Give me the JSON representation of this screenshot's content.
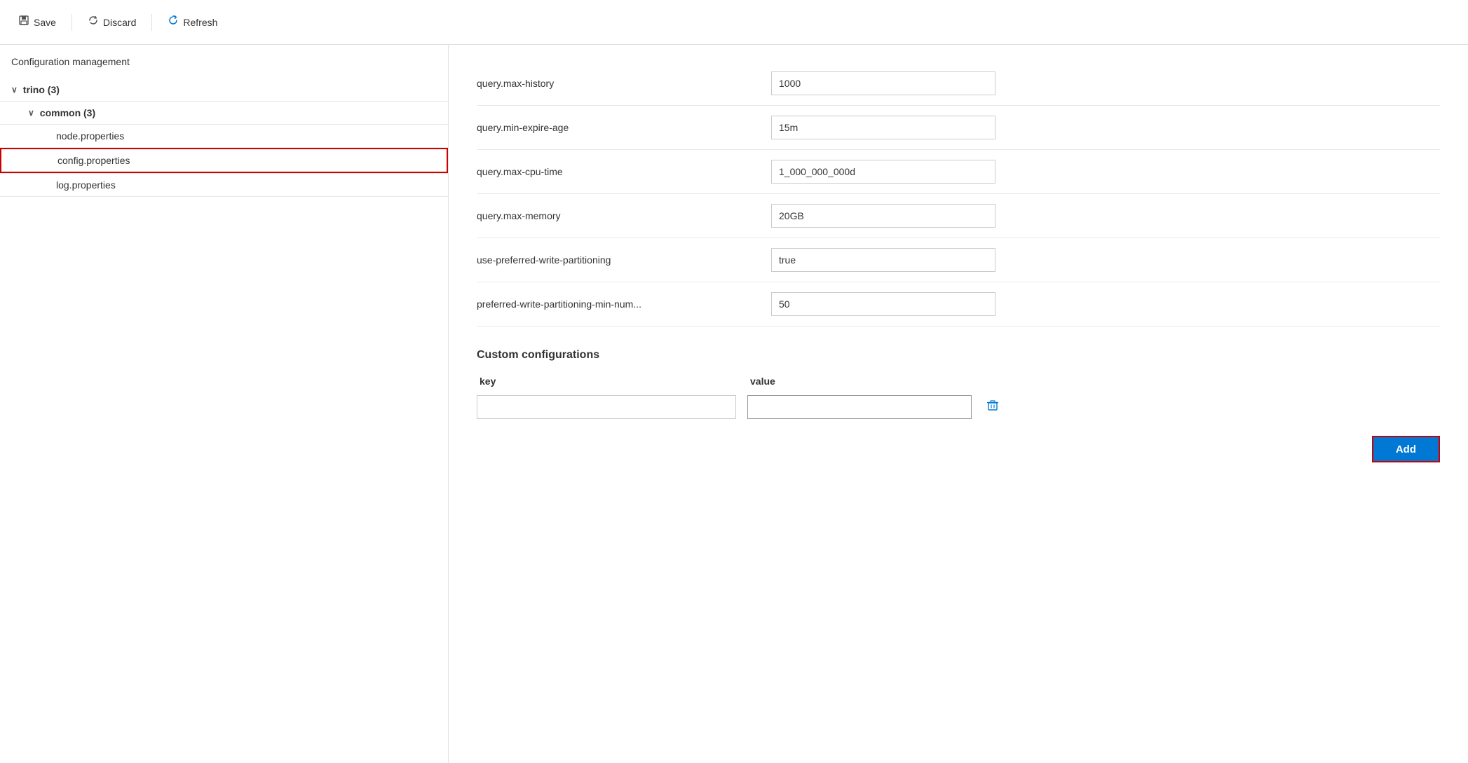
{
  "toolbar": {
    "save_label": "Save",
    "discard_label": "Discard",
    "refresh_label": "Refresh"
  },
  "sidebar": {
    "title": "Configuration management",
    "tree": [
      {
        "id": "trino",
        "label": "trino (3)",
        "level": 0,
        "expanded": true
      },
      {
        "id": "common",
        "label": "common (3)",
        "level": 1,
        "expanded": true
      },
      {
        "id": "node-properties",
        "label": "node.properties",
        "level": 2,
        "selected": false
      },
      {
        "id": "config-properties",
        "label": "config.properties",
        "level": 2,
        "selected": true
      },
      {
        "id": "log-properties",
        "label": "log.properties",
        "level": 2,
        "selected": false
      }
    ]
  },
  "config_rows": [
    {
      "key": "query.max-history",
      "value": "1000"
    },
    {
      "key": "query.min-expire-age",
      "value": "15m"
    },
    {
      "key": "query.max-cpu-time",
      "value": "1_000_000_000d"
    },
    {
      "key": "query.max-memory",
      "value": "20GB"
    },
    {
      "key": "use-preferred-write-partitioning",
      "value": "true"
    },
    {
      "key": "preferred-write-partitioning-min-num...",
      "value": "50"
    }
  ],
  "custom_section": {
    "title": "Custom configurations",
    "key_header": "key",
    "value_header": "value",
    "add_label": "Add"
  },
  "colors": {
    "accent": "#0078d4",
    "selected_border": "#cc0000",
    "add_button_bg": "#0078d4"
  }
}
